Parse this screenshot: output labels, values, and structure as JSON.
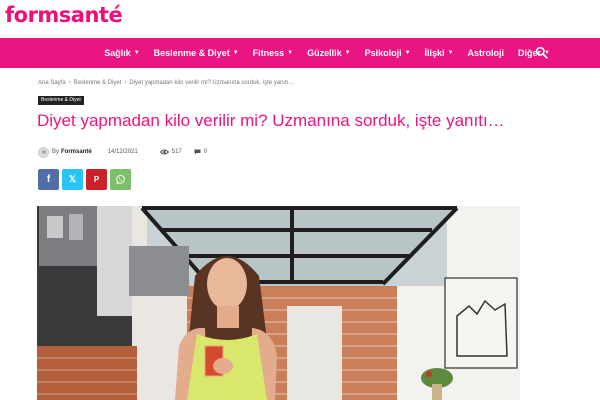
{
  "site": {
    "logo": "formsanté"
  },
  "nav": {
    "items": [
      {
        "label": "Sağlık",
        "has_dropdown": true
      },
      {
        "label": "Beslenme & Diyet",
        "has_dropdown": true
      },
      {
        "label": "Fitness",
        "has_dropdown": true
      },
      {
        "label": "Güzellik",
        "has_dropdown": true
      },
      {
        "label": "Psikoloji",
        "has_dropdown": true
      },
      {
        "label": "İlişki",
        "has_dropdown": true
      },
      {
        "label": "Astroloji",
        "has_dropdown": false
      },
      {
        "label": "Diğer",
        "has_dropdown": true
      }
    ],
    "search_icon": "search-icon"
  },
  "breadcrumb": {
    "home": "Ana Sayfa",
    "category": "Beslenme & Diyet",
    "current": "Diyet yapmadan kilo verilir mi? Uzmanına sorduk, işte yanıtı..."
  },
  "article": {
    "category_tag": "Beslenme & Diyet",
    "title": "Diyet yapmadan kilo verilir mi? Uzmanına sorduk, işte yanıtı…",
    "by": "By",
    "author": "Formsanté",
    "date": "14/12/2021",
    "views": "517",
    "comments": "0"
  },
  "share": {
    "facebook": "f",
    "twitter": "𝕏",
    "pinterest": "P",
    "whatsapp": "W"
  },
  "colors": {
    "brand": "#ea1582",
    "facebook": "#516eab",
    "twitter": "#29c5f6",
    "pinterest": "#ca212a",
    "whatsapp": "#7bbf6a"
  }
}
